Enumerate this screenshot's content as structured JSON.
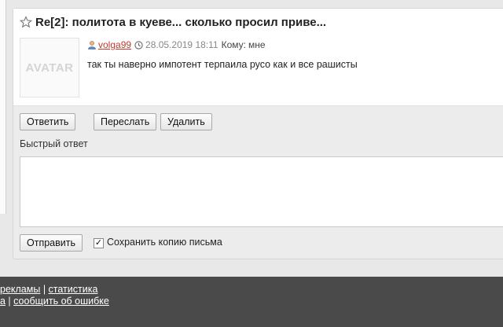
{
  "message": {
    "subject": "Re[2]: политота в куеве... сколько просил приве...",
    "avatar_text": "AVATAR",
    "author": "volga99",
    "date": "28.05.2019 18:11",
    "to_label": "Кому:",
    "to_value": "мне",
    "body": "так ты наверно импотент терпаила русо как и все рашисты"
  },
  "actions": {
    "reply": "Ответить",
    "forward": "Переслать",
    "delete": "Удалить"
  },
  "quick_reply": {
    "label": "Быстрый ответ",
    "text": "",
    "send": "Отправить",
    "save_copy_label": "Сохранить копию письма",
    "save_copy_checked": true
  },
  "footer": {
    "line1_link1": "рекламы",
    "line1_sep": " | ",
    "line1_link2": "статистика",
    "line2_link1": "а",
    "line2_sep": " | ",
    "line2_link2": "сообщить об ошибке"
  }
}
